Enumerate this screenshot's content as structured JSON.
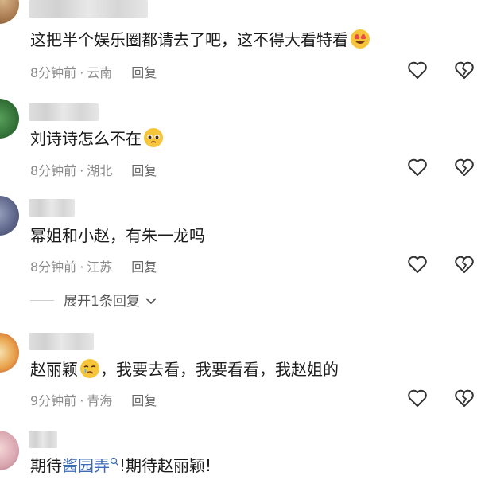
{
  "comments": [
    {
      "text": "这把半个娱乐圈都请去了吧，这不得大看特看",
      "time": "8分钟前",
      "location": "云南",
      "reply": "回复"
    },
    {
      "text": "刘诗诗怎么不在",
      "time": "8分钟前",
      "location": "湖北",
      "reply": "回复"
    },
    {
      "text": "幂姐和小赵，有朱一龙吗",
      "time": "8分钟前",
      "location": "江苏",
      "reply": "回复",
      "expand": "展开1条回复"
    },
    {
      "text_a": "赵丽颖",
      "text_b": "，我要去看，我要看看，我赵姐的",
      "time": "9分钟前",
      "location": "青海",
      "reply": "回复"
    },
    {
      "text_a": "期待",
      "link": "酱园弄",
      "text_b": "!期待赵丽颖!"
    }
  ],
  "separator": "·",
  "icons": {
    "like": "heart-outline-icon",
    "dislike": "broken-heart-icon"
  }
}
